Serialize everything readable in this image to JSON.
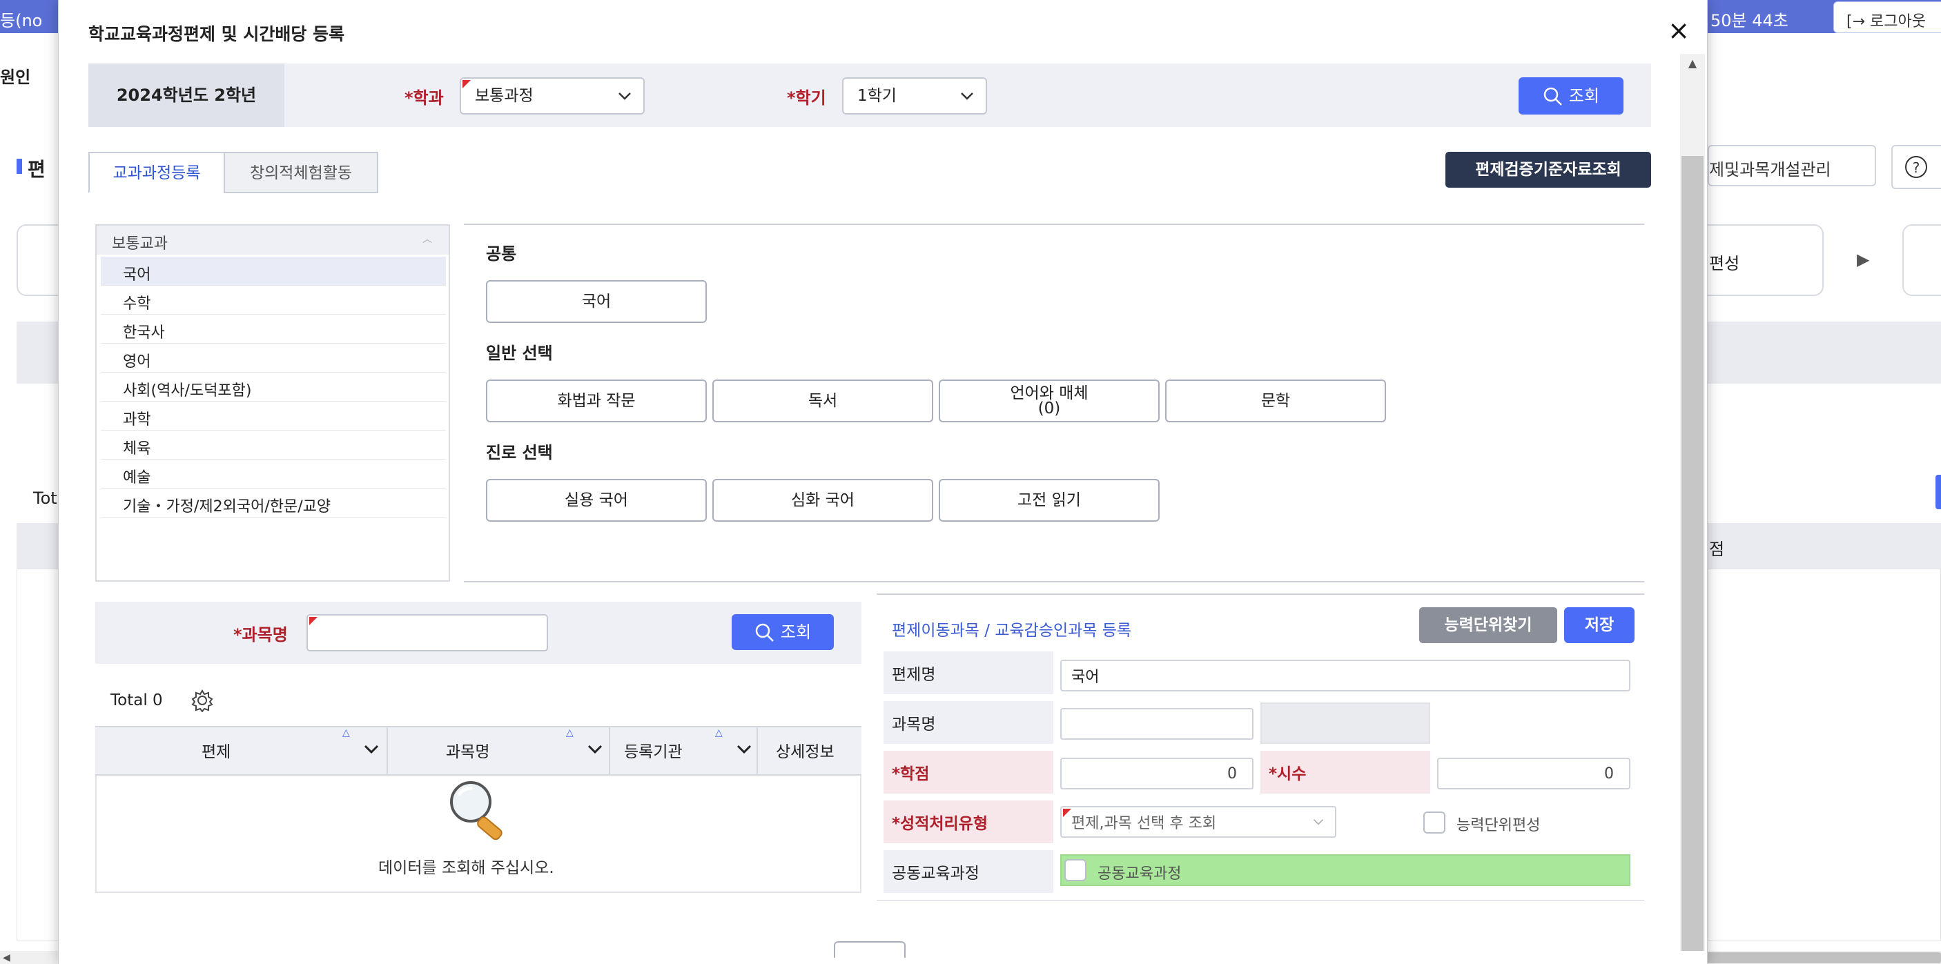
{
  "background": {
    "topbar_left": "등(no",
    "timer": "50분 44초",
    "logout_label": "로그아웃",
    "left_text_1": "원인",
    "left_text_2": "편",
    "right_link": "제및과목개설관리",
    "help_icon": "?",
    "step_label": "편성",
    "step_arrow": "▶",
    "total_fragment": "Tot",
    "col_fragment": "점"
  },
  "modal": {
    "title": "학교교육과정편제 및 시간배당 등록",
    "close_label": "×"
  },
  "search": {
    "grade": "2024학년도 2학년",
    "dept_label": "*학과",
    "dept_value": "보통과정",
    "semester_label": "*학기",
    "semester_value": "1학기",
    "search_button": "조회"
  },
  "tabs": [
    {
      "label": "교과과정등록",
      "active": true
    },
    {
      "label": "창의적체험활동",
      "active": false
    }
  ],
  "verify_button": "편제검증기준자료조회",
  "subject_list": {
    "header": "보통교과",
    "items": [
      "국어",
      "수학",
      "한국사",
      "영어",
      "사회(역사/도덕포함)",
      "과학",
      "체육",
      "예술",
      "기술・가정/제2외국어/한문/교양"
    ],
    "selected": "국어"
  },
  "subject_groups": [
    {
      "title": "공통",
      "subjects": [
        "국어"
      ]
    },
    {
      "title": "일반 선택",
      "subjects": [
        "화법과 작문",
        "독서",
        "언어와 매체\n(0)",
        "문학"
      ]
    },
    {
      "title": "진로 선택",
      "subjects": [
        "실용 국어",
        "심화 국어",
        "고전 읽기"
      ]
    }
  ],
  "course_search": {
    "label": "*과목명",
    "value": "",
    "button": "조회",
    "total": "Total 0",
    "columns": [
      "편제",
      "과목명",
      "등록기관",
      "상세정보"
    ],
    "empty_message": "데이터를 조회해 주십시오."
  },
  "register_form": {
    "title": "편제이동과목 / 교육감승인과목 등록",
    "find_button": "능력단위찾기",
    "save_button": "저장",
    "rows": {
      "curriculum_label": "편제명",
      "curriculum_value": "국어",
      "subject_label": "과목명",
      "subject_value": "",
      "credit_label": "*학점",
      "credit_value": "0",
      "hours_label": "*시수",
      "hours_value": "0",
      "grading_label": "*성적처리유형",
      "grading_value": "편제,과목 선택 후 조회",
      "ability_label": "능력단위편성",
      "common_label": "공동교육과정",
      "common_checkbox_label": "공동교육과정"
    }
  },
  "colors": {
    "accent_blue": "#4a6cf7",
    "navy": "#2b3651",
    "required_red": "#b0202a",
    "green_highlight": "#a9e79a"
  }
}
